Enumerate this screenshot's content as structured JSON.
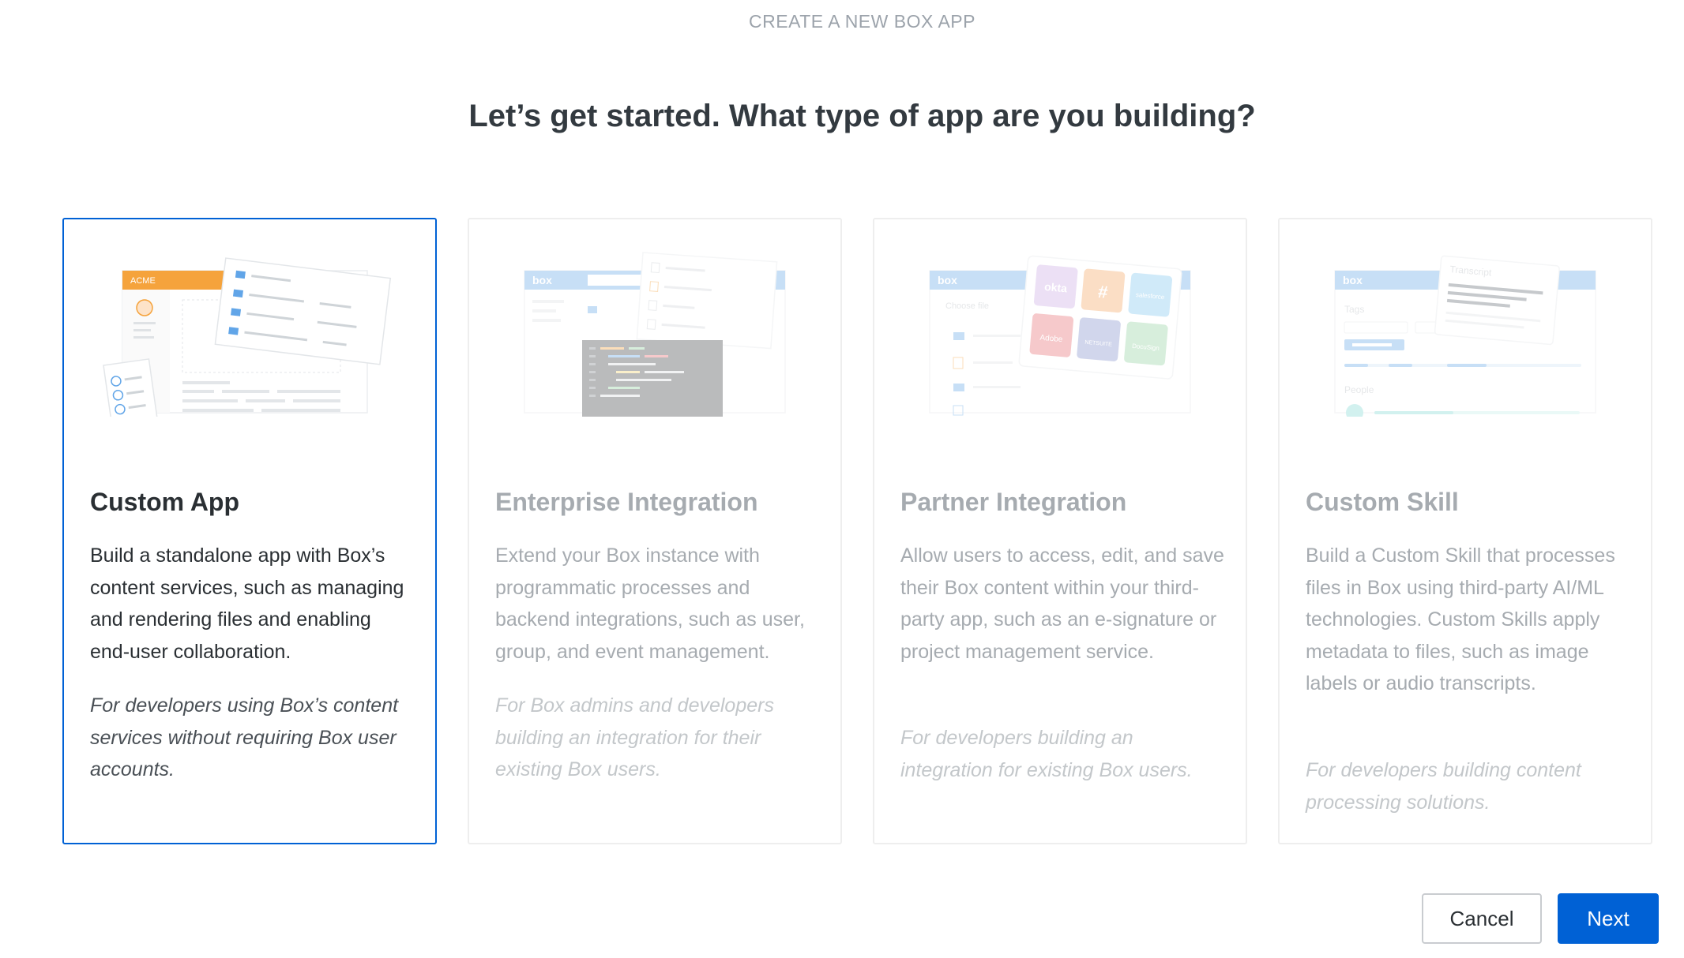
{
  "header": {
    "eyebrow": "CREATE A NEW BOX APP",
    "title": "Let’s get started. What type of app are you building?"
  },
  "cards": [
    {
      "title": "Custom App",
      "description": "Build a standalone app with Box’s content services, such as managing and rendering files and enabling end-user collaboration.",
      "audience": "For developers using Box’s content services without requiring Box user accounts.",
      "selected": true,
      "illustration": {
        "brand_label": "ACME"
      }
    },
    {
      "title": "Enterprise Integration",
      "description": "Extend your Box instance with programmatic processes and backend integrations, such as user, group, and event management.",
      "audience": "For Box admins and developers building an integration for their existing Box users.",
      "selected": false,
      "illustration": {
        "brand_label": "box"
      }
    },
    {
      "title": "Partner Integration",
      "description": "Allow users to access, edit, and save their Box content within your third-party app, such as an e-signature or project management service.",
      "audience": "For developers building an integration for existing Box users.",
      "selected": false,
      "illustration": {
        "brand_label": "box",
        "choose_file_label": "Choose file",
        "partner_tiles": [
          {
            "label": "okta",
            "color": "#c9a8e3"
          },
          {
            "label": "#",
            "color": "#f6a25b"
          },
          {
            "label": "salesforce",
            "color": "#7cc6ee"
          },
          {
            "label": "Adobe",
            "color": "#e8676c"
          },
          {
            "label": "NETSUITE",
            "color": "#7e8dc9"
          },
          {
            "label": "DocuSign",
            "color": "#8fd19e"
          }
        ]
      }
    },
    {
      "title": "Custom Skill",
      "description": "Build a Custom Skill that processes files in Box using third-party AI/ML technologies. Custom Skills apply metadata to files, such as image labels or audio transcripts.",
      "audience": "For developers building content processing solutions.",
      "selected": false,
      "illustration": {
        "brand_label": "box",
        "transcript_label": "Transcript",
        "tags_label": "Tags",
        "people_label": "People"
      }
    }
  ],
  "footer": {
    "cancel_label": "Cancel",
    "next_label": "Next"
  },
  "colors": {
    "accent": "#0061d5",
    "acme_orange": "#f5a33c",
    "box_blue": "#61a5e8"
  }
}
